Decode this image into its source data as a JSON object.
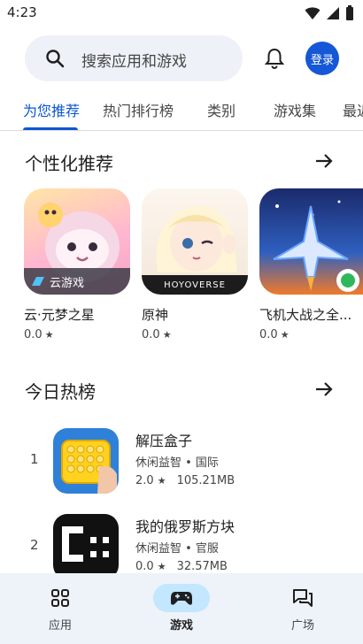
{
  "status_bar": {
    "time": "4:23"
  },
  "search": {
    "placeholder": "搜索应用和游戏"
  },
  "header": {
    "login_label": "登录"
  },
  "tabs": [
    {
      "label": "为您推荐",
      "active": true
    },
    {
      "label": "热门排行榜",
      "active": false
    },
    {
      "label": "类别",
      "active": false
    },
    {
      "label": "游戏集",
      "active": false
    },
    {
      "label": "最近",
      "active": false
    }
  ],
  "personalized": {
    "title": "个性化推荐",
    "apps": [
      {
        "name": "云·元梦之星",
        "rating": "0.0",
        "badge_text": "云游戏"
      },
      {
        "name": "原神",
        "rating": "0.0",
        "badge_text": "HOYOVERSE"
      },
      {
        "name": "飞机大战之全...",
        "rating": "0.0"
      }
    ]
  },
  "hot_list": {
    "title": "今日热榜",
    "items": [
      {
        "rank": "1",
        "name": "解压盒子",
        "subtitle": "休闲益智 • 国际",
        "rating": "2.0",
        "size": "105.21MB"
      },
      {
        "rank": "2",
        "name": "我的俄罗斯方块",
        "subtitle": "休闲益智 • 官服",
        "rating": "0.0",
        "size": "32.57MB"
      }
    ]
  },
  "bottom_nav": [
    {
      "label": "应用",
      "icon": "apps-grid-icon",
      "active": false
    },
    {
      "label": "游戏",
      "icon": "gamepad-icon",
      "active": true
    },
    {
      "label": "广场",
      "icon": "forum-icon",
      "active": false
    }
  ],
  "colors": {
    "accent": "#0b57d0",
    "login_bg": "#1557d6",
    "nav_bg": "#eef2f9",
    "nav_active": "#c2e7ff",
    "search_bg": "#eef1f7"
  }
}
